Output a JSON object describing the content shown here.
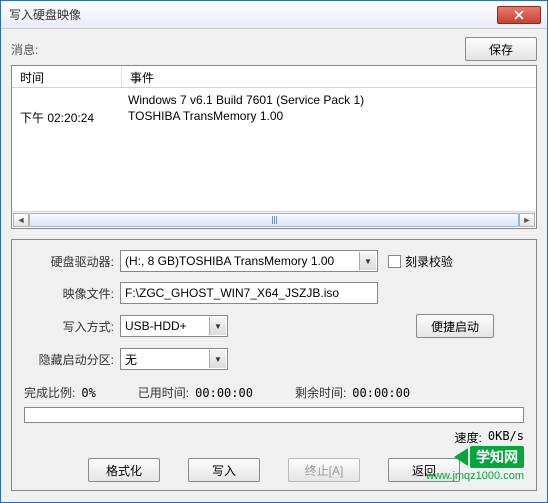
{
  "window": {
    "title": "写入硬盘映像"
  },
  "messages": {
    "label": "消息:",
    "save_button": "保存"
  },
  "table": {
    "headers": {
      "time": "时间",
      "event": "事件"
    },
    "rows": [
      {
        "time": "",
        "event": "Windows 7 v6.1 Build 7601 (Service Pack 1)"
      },
      {
        "time": "下午 02:20:24",
        "event": "TOSHIBA TransMemory    1.00"
      }
    ]
  },
  "form": {
    "drive_label": "硬盘驱动器:",
    "drive_value": "(H:, 8 GB)TOSHIBA TransMemory    1.00",
    "verify_label": "刻录校验",
    "image_label": "映像文件:",
    "image_value": "F:\\ZGC_GHOST_WIN7_X64_JSZJB.iso",
    "write_mode_label": "写入方式:",
    "write_mode_value": "USB-HDD+",
    "quick_boot_button": "便捷启动",
    "hidden_partition_label": "隐藏启动分区:",
    "hidden_partition_value": "无"
  },
  "stats": {
    "percent_label": "完成比例:",
    "percent_value": "0%",
    "elapsed_label": "已用时间:",
    "elapsed_value": "00:00:00",
    "remaining_label": "剩余时间:",
    "remaining_value": "00:00:00",
    "speed_label": "速度:",
    "speed_value": "0KB/s"
  },
  "buttons": {
    "format": "格式化",
    "write": "写入",
    "abort": "终止[A]",
    "back": "返回"
  },
  "watermark": {
    "text": "学知网",
    "url": "www.jmqz1000.com"
  }
}
